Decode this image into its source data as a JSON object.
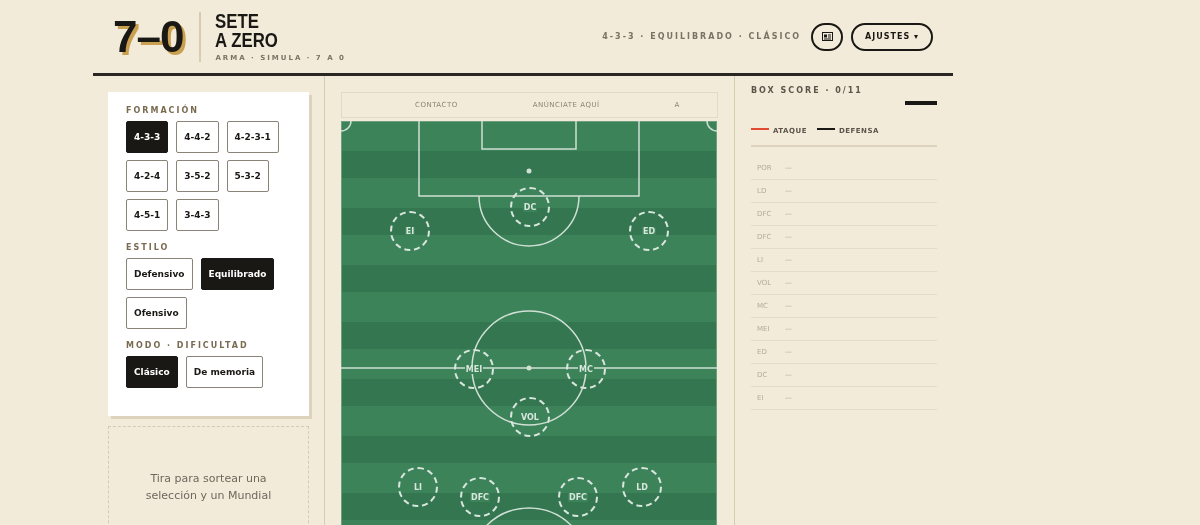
{
  "header": {
    "logo": "7–0",
    "title_lines": [
      "SETE",
      "A ZERO"
    ],
    "tagline": "ARMA · SIMULA · 7 A 0",
    "summary": "4-3-3 · EQUILIBRADO · CLÁSICO",
    "settings_button": "AJUSTES",
    "settings_caret": "▾"
  },
  "sidebar": {
    "sections": [
      {
        "title": "FORMACIÓN",
        "options": [
          {
            "label": "4-3-3",
            "selected": true
          },
          {
            "label": "4-4-2",
            "selected": false
          },
          {
            "label": "4-2-3-1",
            "selected": false
          },
          {
            "label": "4-2-4",
            "selected": false
          },
          {
            "label": "3-5-2",
            "selected": false
          },
          {
            "label": "5-3-2",
            "selected": false
          },
          {
            "label": "4-5-1",
            "selected": false
          },
          {
            "label": "3-4-3",
            "selected": false
          }
        ]
      },
      {
        "title": "ESTILO",
        "options": [
          {
            "label": "Defensivo",
            "selected": false
          },
          {
            "label": "Equilibrado",
            "selected": true
          },
          {
            "label": "Ofensivo",
            "selected": false
          }
        ]
      },
      {
        "title": "MODO · DIFICULTAD",
        "options": [
          {
            "label": "Clásico",
            "selected": true
          },
          {
            "label": "De memoria",
            "selected": false
          }
        ]
      }
    ],
    "draw_prompt": "Tira para sortear una selección y un Mundial"
  },
  "ticker": [
    "CONTACTO",
    "ANÚNCIATE AQUÍ",
    "A"
  ],
  "pitch": {
    "players": [
      {
        "label": "EI"
      },
      {
        "label": "DC"
      },
      {
        "label": "ED"
      },
      {
        "label": "MEI"
      },
      {
        "label": "MC"
      },
      {
        "label": "VOL"
      },
      {
        "label": "LI"
      },
      {
        "label": "DFC"
      },
      {
        "label": "DFC"
      },
      {
        "label": "LD"
      }
    ]
  },
  "box_score": {
    "title": "BOX SCORE · 0/11",
    "legend": [
      {
        "label": "ATAQUE",
        "color": "#e04a33"
      },
      {
        "label": "DEFENSA",
        "color": "#1a1814"
      }
    ],
    "rows": [
      {
        "position": "POR",
        "value": "—"
      },
      {
        "position": "LD",
        "value": "—"
      },
      {
        "position": "DFC",
        "value": "—"
      },
      {
        "position": "DFC",
        "value": "—"
      },
      {
        "position": "LI",
        "value": "—"
      },
      {
        "position": "VOL",
        "value": "—"
      },
      {
        "position": "MC",
        "value": "—"
      },
      {
        "position": "MEI",
        "value": "—"
      },
      {
        "position": "ED",
        "value": "—"
      },
      {
        "position": "DC",
        "value": "—"
      },
      {
        "position": "EI",
        "value": "—"
      }
    ]
  }
}
